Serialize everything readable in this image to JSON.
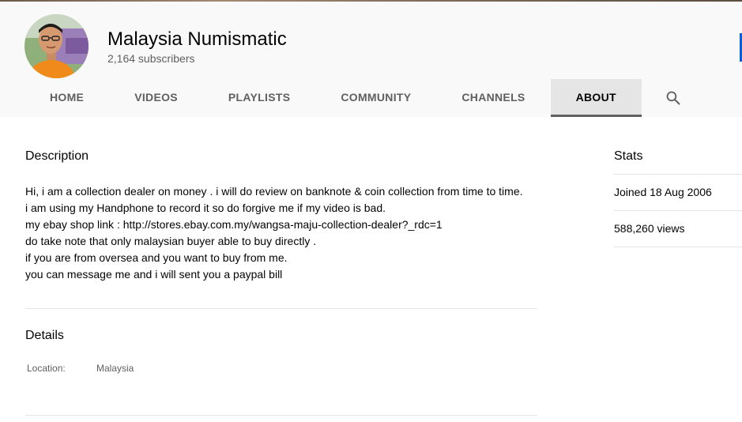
{
  "channel": {
    "name": "Malaysia Numismatic",
    "subscribers": "2,164 subscribers"
  },
  "tabs": [
    {
      "label": "HOME",
      "active": false
    },
    {
      "label": "VIDEOS",
      "active": false
    },
    {
      "label": "PLAYLISTS",
      "active": false
    },
    {
      "label": "COMMUNITY",
      "active": false
    },
    {
      "label": "CHANNELS",
      "active": false
    },
    {
      "label": "ABOUT",
      "active": true
    }
  ],
  "search_icon": "search-icon",
  "about": {
    "description_heading": "Description",
    "description_lines": [
      "Hi, i am a collection dealer on money . i will do review on banknote & coin collection from time to time.",
      "i am using my Handphone to record it so do forgive me if my video is bad.",
      "my ebay shop link : http://stores.ebay.com.my/wangsa-maju-collection-dealer?_rdc=1",
      "do take note that only malaysian buyer able to buy directly .",
      "if you are from oversea and you want to buy from me.",
      "you can message me and i will sent you a paypal bill"
    ],
    "details_heading": "Details",
    "location_label": "Location:",
    "location_value": "Malaysia"
  },
  "stats": {
    "heading": "Stats",
    "joined": "Joined 18 Aug 2006",
    "views": "588,260 views"
  },
  "colors": {
    "header_bg": "#f9f9f9",
    "active_tab_bg": "#e5e5e5",
    "active_tab_underline": "#606060",
    "accent": "#065fd4"
  }
}
